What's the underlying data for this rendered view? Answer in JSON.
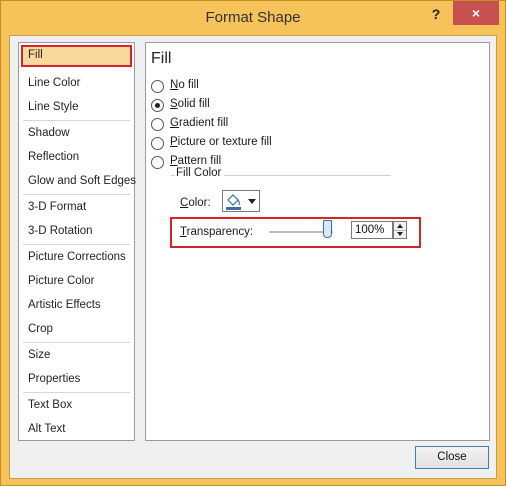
{
  "window": {
    "title": "Format Shape",
    "help": "?",
    "close": "×"
  },
  "sidebar": {
    "items": [
      {
        "label": "Fill",
        "selected": true
      },
      {
        "label": "Line Color"
      },
      {
        "label": "Line Style"
      },
      {
        "label": "Shadow"
      },
      {
        "label": "Reflection"
      },
      {
        "label": "Glow and Soft Edges"
      },
      {
        "label": "3-D Format"
      },
      {
        "label": "3-D Rotation"
      },
      {
        "label": "Picture Corrections"
      },
      {
        "label": "Picture Color"
      },
      {
        "label": "Artistic Effects"
      },
      {
        "label": "Crop"
      },
      {
        "label": "Size"
      },
      {
        "label": "Properties"
      },
      {
        "label": "Text Box"
      },
      {
        "label": "Alt Text"
      }
    ]
  },
  "main": {
    "title": "Fill",
    "options": [
      {
        "label": "No fill",
        "mnemonic": "N",
        "rest": "o fill",
        "checked": false
      },
      {
        "label": "Solid fill",
        "mnemonic": "S",
        "rest": "olid fill",
        "checked": true
      },
      {
        "label": "Gradient fill",
        "mnemonic": "G",
        "rest": "radient fill",
        "checked": false
      },
      {
        "label": "Picture or texture fill",
        "mnemonic": "P",
        "rest": "icture or texture fill",
        "checked": false
      },
      {
        "label": "Pattern fill",
        "mnemonic": "P",
        "rest": "attern fill",
        "checked": false
      }
    ],
    "fill_color": {
      "group_title": "Fill Color",
      "color_label_m": "C",
      "color_label_rest": "olor:",
      "color_icon": "paint-bucket-icon",
      "transparency_label_m": "T",
      "transparency_label_rest": "ransparency:",
      "transparency_value": "100%",
      "transparency_level": 1.0
    }
  },
  "footer": {
    "close_label": "Close"
  },
  "colors": {
    "title_bar": "#f5c35a",
    "highlight": "#d8232a",
    "selected_bg": "#f9d89b"
  }
}
